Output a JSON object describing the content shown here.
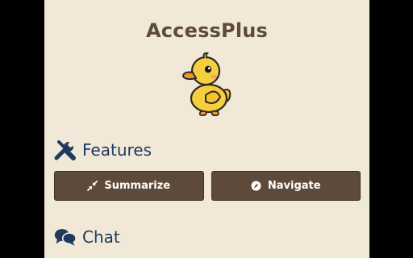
{
  "app": {
    "title": "AccessPlus",
    "mascot_icon": "duck-icon"
  },
  "features": {
    "heading": "Features",
    "heading_icon": "tools-icon",
    "buttons": [
      {
        "label": "Summarize",
        "icon": "compress-arrows-icon"
      },
      {
        "label": "Navigate",
        "icon": "compass-icon"
      }
    ]
  },
  "chat": {
    "heading": "Chat",
    "heading_icon": "comments-icon"
  },
  "colors": {
    "background": "#f1e8d8",
    "title": "#5e4a36",
    "heading": "#1f3a5c",
    "button": "#5e4a3a",
    "button_text": "#ffffff"
  }
}
